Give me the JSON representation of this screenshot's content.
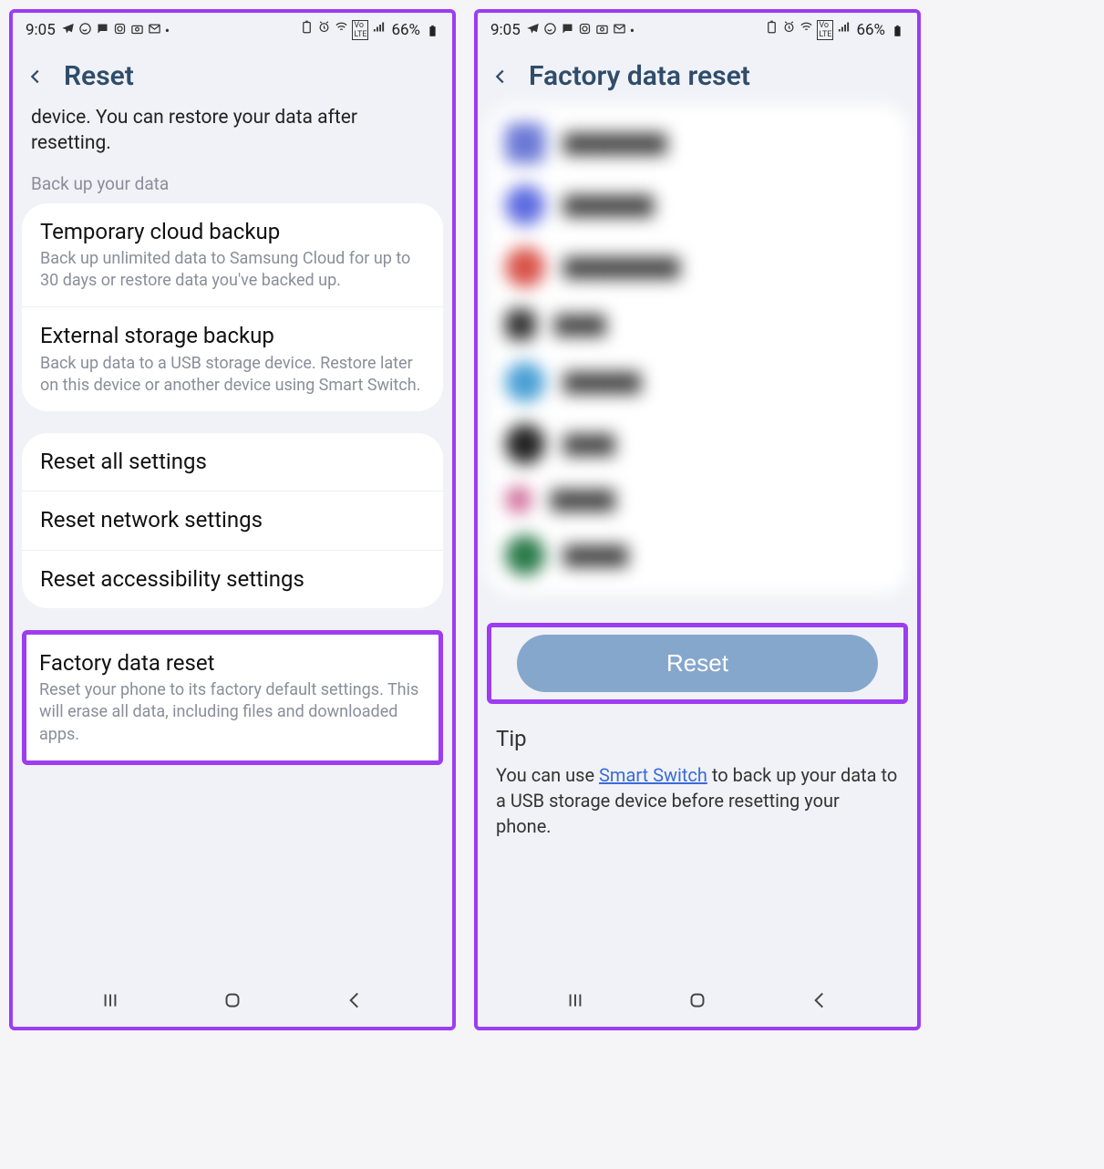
{
  "status": {
    "time": "9:05",
    "battery_text": "66%"
  },
  "left": {
    "title": "Reset",
    "intro": "device. You can restore your data after resetting.",
    "section_label": "Back up your data",
    "backup": [
      {
        "title": "Temporary cloud backup",
        "desc": "Back up unlimited data to Samsung Cloud for up to 30 days or restore data you've backed up."
      },
      {
        "title": "External storage backup",
        "desc": "Back up data to a USB storage device. Restore later on this device or another device using Smart Switch."
      }
    ],
    "reset_options": [
      {
        "title": "Reset all settings"
      },
      {
        "title": "Reset network settings"
      },
      {
        "title": "Reset accessibility settings"
      }
    ],
    "factory": {
      "title": "Factory data reset",
      "desc": "Reset your phone to its factory default settings. This will erase all data, including files and downloaded apps."
    }
  },
  "right": {
    "title": "Factory data reset",
    "apps": [
      {
        "color": "#6b79d6"
      },
      {
        "color": "#5d6be0"
      },
      {
        "color": "#d9534a"
      },
      {
        "color": "#333"
      },
      {
        "color": "#4aa0d5"
      },
      {
        "color": "#222"
      },
      {
        "color": "#d06f9a"
      },
      {
        "color": "#2a7a4a"
      }
    ],
    "reset_button": "Reset",
    "tip_title": "Tip",
    "tip_text_pre": "You can use ",
    "tip_link": "Smart Switch",
    "tip_text_post": " to back up your data to a USB storage device before resetting your phone."
  }
}
